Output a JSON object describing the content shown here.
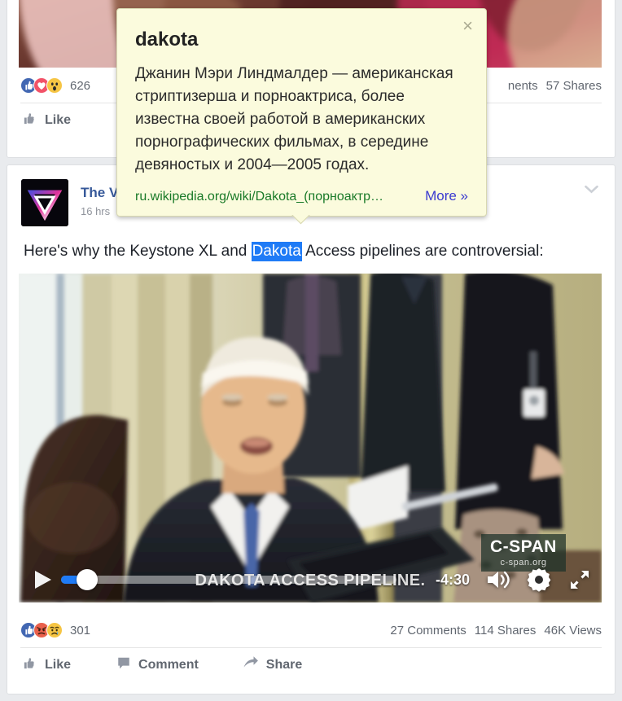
{
  "post_one": {
    "reactions": {
      "icons": [
        "like-icon",
        "love-icon",
        "wow-icon"
      ],
      "count": "626"
    },
    "stats": {
      "comments": "nents",
      "shares": "57 Shares"
    },
    "actions": [
      {
        "name": "like",
        "label": "Like",
        "icon": "thumbs-up-icon"
      }
    ]
  },
  "post_two": {
    "page_name": "The V",
    "page_name_full": "The Verge",
    "timestamp": "16 hrs",
    "menu_icon": "chevron-down-icon",
    "avatar_icon": "verge-logo-icon",
    "message_before": "Here's why the Keystone XL and ",
    "message_highlight": "Dakota",
    "message_after": " Access pipelines are controversial:",
    "video": {
      "caption": "DAKOTA ACCESS PIPELINE.",
      "time_remaining": "-4:30",
      "progress_percent": 6,
      "watermark_main": "C-SPAN",
      "watermark_sub": "c-span.org",
      "play_icon": "play-icon",
      "volume_icon": "volume-icon",
      "settings_icon": "gear-icon",
      "fullscreen_icon": "fullscreen-icon"
    },
    "reactions": {
      "icons": [
        "like-icon",
        "angry-icon",
        "sad-icon"
      ],
      "count": "301"
    },
    "stats": {
      "comments": "27 Comments",
      "shares": "114 Shares",
      "views": "46K Views"
    },
    "actions": [
      {
        "name": "like",
        "label": "Like",
        "icon": "thumbs-up-icon"
      },
      {
        "name": "comment",
        "label": "Comment",
        "icon": "comment-icon"
      },
      {
        "name": "share",
        "label": "Share",
        "icon": "share-arrow-icon"
      }
    ]
  },
  "tooltip": {
    "title": "dakota",
    "body": "Джанин Мэри Линдмалдер — американская стриптизерша и порноактриса, более известна своей работой в американских порнографических фильмах, в середине девяностых и 2004—2005 годах.",
    "url": "ru.wikipedia.org/wiki/Dakota_(порноактр…",
    "more_label": "More »",
    "close_icon": "close-icon"
  },
  "colors": {
    "accent_blue": "#4267b2",
    "selection_blue": "#1f7bf6",
    "tooltip_bg": "#fbfbdd",
    "link_green": "#1a7a28",
    "more_purple": "#3a3ad0",
    "page_bg": "#e9ebee"
  }
}
